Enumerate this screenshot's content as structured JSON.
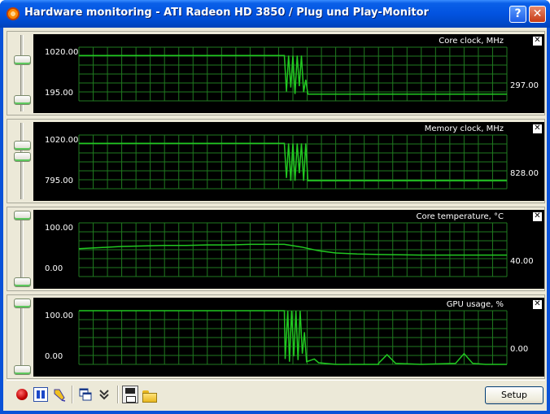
{
  "window": {
    "title": "Hardware monitoring - ATI Radeon HD 3850 / Plug und Play-Monitor",
    "help_glyph": "?",
    "close_glyph": "✕"
  },
  "graphs": [
    {
      "title": "Core clock, MHz",
      "max_label": "1020.00",
      "min_label": "195.00",
      "current_label": "297.00",
      "close_glyph": "✕",
      "chart_data": {
        "type": "line",
        "ylim": [
          195,
          1020
        ],
        "samples": [
          [
            0,
            891
          ],
          [
            0.48,
            891
          ],
          [
            0.485,
            340
          ],
          [
            0.49,
            891
          ],
          [
            0.495,
            400
          ],
          [
            0.5,
            891
          ],
          [
            0.505,
            300
          ],
          [
            0.51,
            891
          ],
          [
            0.515,
            420
          ],
          [
            0.52,
            891
          ],
          [
            0.525,
            330
          ],
          [
            0.53,
            520
          ],
          [
            0.535,
            297
          ],
          [
            1,
            297
          ]
        ],
        "grid": true
      }
    },
    {
      "title": "Memory clock, MHz",
      "max_label": "1020.00",
      "min_label": "795.00",
      "current_label": "828.00",
      "close_glyph": "✕",
      "chart_data": {
        "type": "line",
        "ylim": [
          795,
          1020
        ],
        "samples": [
          [
            0,
            985
          ],
          [
            0.48,
            985
          ],
          [
            0.485,
            840
          ],
          [
            0.49,
            985
          ],
          [
            0.495,
            828
          ],
          [
            0.5,
            985
          ],
          [
            0.505,
            828
          ],
          [
            0.51,
            985
          ],
          [
            0.515,
            860
          ],
          [
            0.52,
            985
          ],
          [
            0.525,
            828
          ],
          [
            0.53,
            985
          ],
          [
            0.535,
            828
          ],
          [
            1,
            828
          ]
        ],
        "grid": true
      }
    },
    {
      "title": "Core temperature, °C",
      "max_label": "100.00",
      "min_label": "0.00",
      "current_label": "40.00",
      "close_glyph": "✕",
      "chart_data": {
        "type": "line",
        "ylim": [
          0,
          100
        ],
        "samples": [
          [
            0,
            52
          ],
          [
            0.05,
            54
          ],
          [
            0.1,
            56
          ],
          [
            0.15,
            57
          ],
          [
            0.2,
            58
          ],
          [
            0.25,
            58
          ],
          [
            0.3,
            59
          ],
          [
            0.35,
            59
          ],
          [
            0.4,
            60
          ],
          [
            0.45,
            60
          ],
          [
            0.48,
            60
          ],
          [
            0.52,
            55
          ],
          [
            0.56,
            48
          ],
          [
            0.6,
            44
          ],
          [
            0.65,
            42
          ],
          [
            0.7,
            41
          ],
          [
            0.8,
            40
          ],
          [
            0.9,
            40
          ],
          [
            1,
            40
          ]
        ],
        "grid": true
      }
    },
    {
      "title": "GPU usage, %",
      "max_label": "100.00",
      "min_label": "0.00",
      "current_label": "0.00",
      "close_glyph": "✕",
      "chart_data": {
        "type": "line",
        "ylim": [
          0,
          100
        ],
        "samples": [
          [
            0,
            100
          ],
          [
            0.48,
            100
          ],
          [
            0.482,
            10
          ],
          [
            0.488,
            100
          ],
          [
            0.492,
            5
          ],
          [
            0.497,
            100
          ],
          [
            0.502,
            15
          ],
          [
            0.507,
            100
          ],
          [
            0.512,
            8
          ],
          [
            0.517,
            100
          ],
          [
            0.522,
            20
          ],
          [
            0.527,
            60
          ],
          [
            0.532,
            5
          ],
          [
            0.55,
            10
          ],
          [
            0.56,
            3
          ],
          [
            0.6,
            0
          ],
          [
            0.7,
            0
          ],
          [
            0.7,
            2
          ],
          [
            0.72,
            18
          ],
          [
            0.74,
            2
          ],
          [
            0.8,
            0
          ],
          [
            0.88,
            2
          ],
          [
            0.9,
            20
          ],
          [
            0.92,
            2
          ],
          [
            0.95,
            0
          ],
          [
            1,
            0
          ]
        ],
        "grid": true
      }
    }
  ],
  "toolbar": {
    "setup_label": "Setup",
    "chevron_glyph": "»"
  },
  "colors": {
    "line": "#21c821",
    "grid": "#1f7a1f",
    "background": "#000000"
  }
}
